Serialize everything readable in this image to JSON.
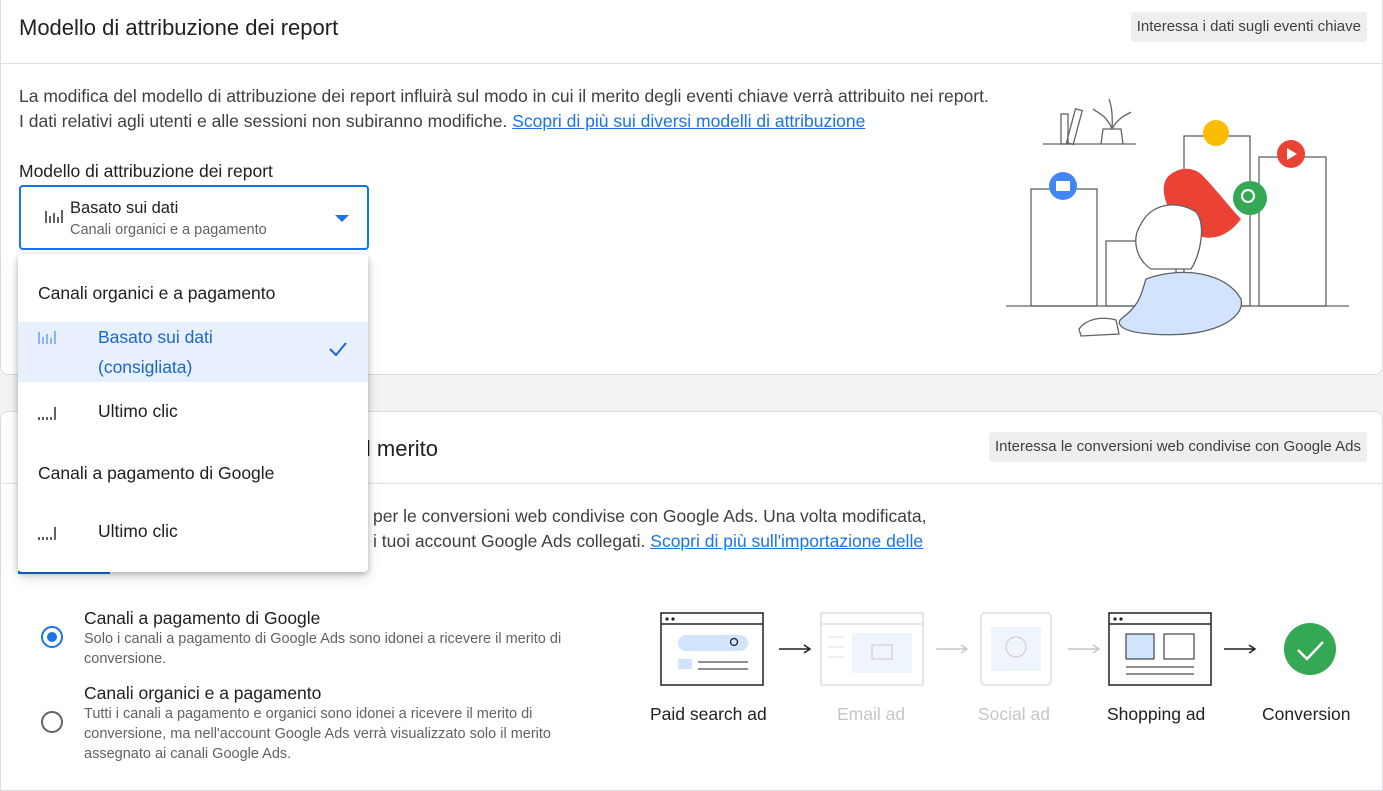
{
  "section1": {
    "title": "Modello di attribuzione dei report",
    "chip": "Interessa i dati sugli eventi chiave",
    "description": "La modifica del modello di attribuzione dei report influirà sul modo in cui il merito degli eventi chiave verrà attribuito nei report. I dati relativi agli utenti e alle sessioni non subiranno modifiche.",
    "link": "Scopri di più sui diversi modelli di attribuzione",
    "field_label": "Modello di attribuzione dei report",
    "select": {
      "value": "Basato sui dati",
      "sub": "Canali organici e a pagamento"
    }
  },
  "dropdown": {
    "group1": "Canali organici e a pagamento",
    "option1_line1": "Basato sui dati",
    "option1_line2": "(consigliata)",
    "option2": "Ultimo clic",
    "group2": "Canali a pagamento di Google",
    "option3": "Ultimo clic"
  },
  "section2": {
    "title_visible": "il merito",
    "chip": "Interessa le conversioni web condivise con Google Ads",
    "description_line1": "per le conversioni web condivise con Google Ads. Una volta modificata,",
    "description_line2": "i tuoi account Google Ads collegati.",
    "link": "Scopri di più sull'importazione delle",
    "radio1_title": "Canali a pagamento di Google",
    "radio1_desc": "Solo i canali a pagamento di Google Ads sono idonei a ricevere il merito di conversione.",
    "radio2_title": "Canali organici e a pagamento",
    "radio2_desc": "Tutti i canali a pagamento e organici sono idonei a ricevere il merito di conversione, ma nell'account Google Ads verrà visualizzato solo il merito assegnato ai canali Google Ads.",
    "radio1_selected": true
  },
  "flow": {
    "paid_search": "Paid search ad",
    "email": "Email ad",
    "social": "Social ad",
    "shopping": "Shopping ad",
    "conversion": "Conversion"
  },
  "colors": {
    "accent": "#1a73e8",
    "selected_bg": "#e8f0fe",
    "conversion_green": "#34a853"
  },
  "icons": [
    "bar-chart-icon",
    "last-click-icon",
    "check-icon",
    "arrow-icon",
    "checkmark-circle-icon"
  ]
}
